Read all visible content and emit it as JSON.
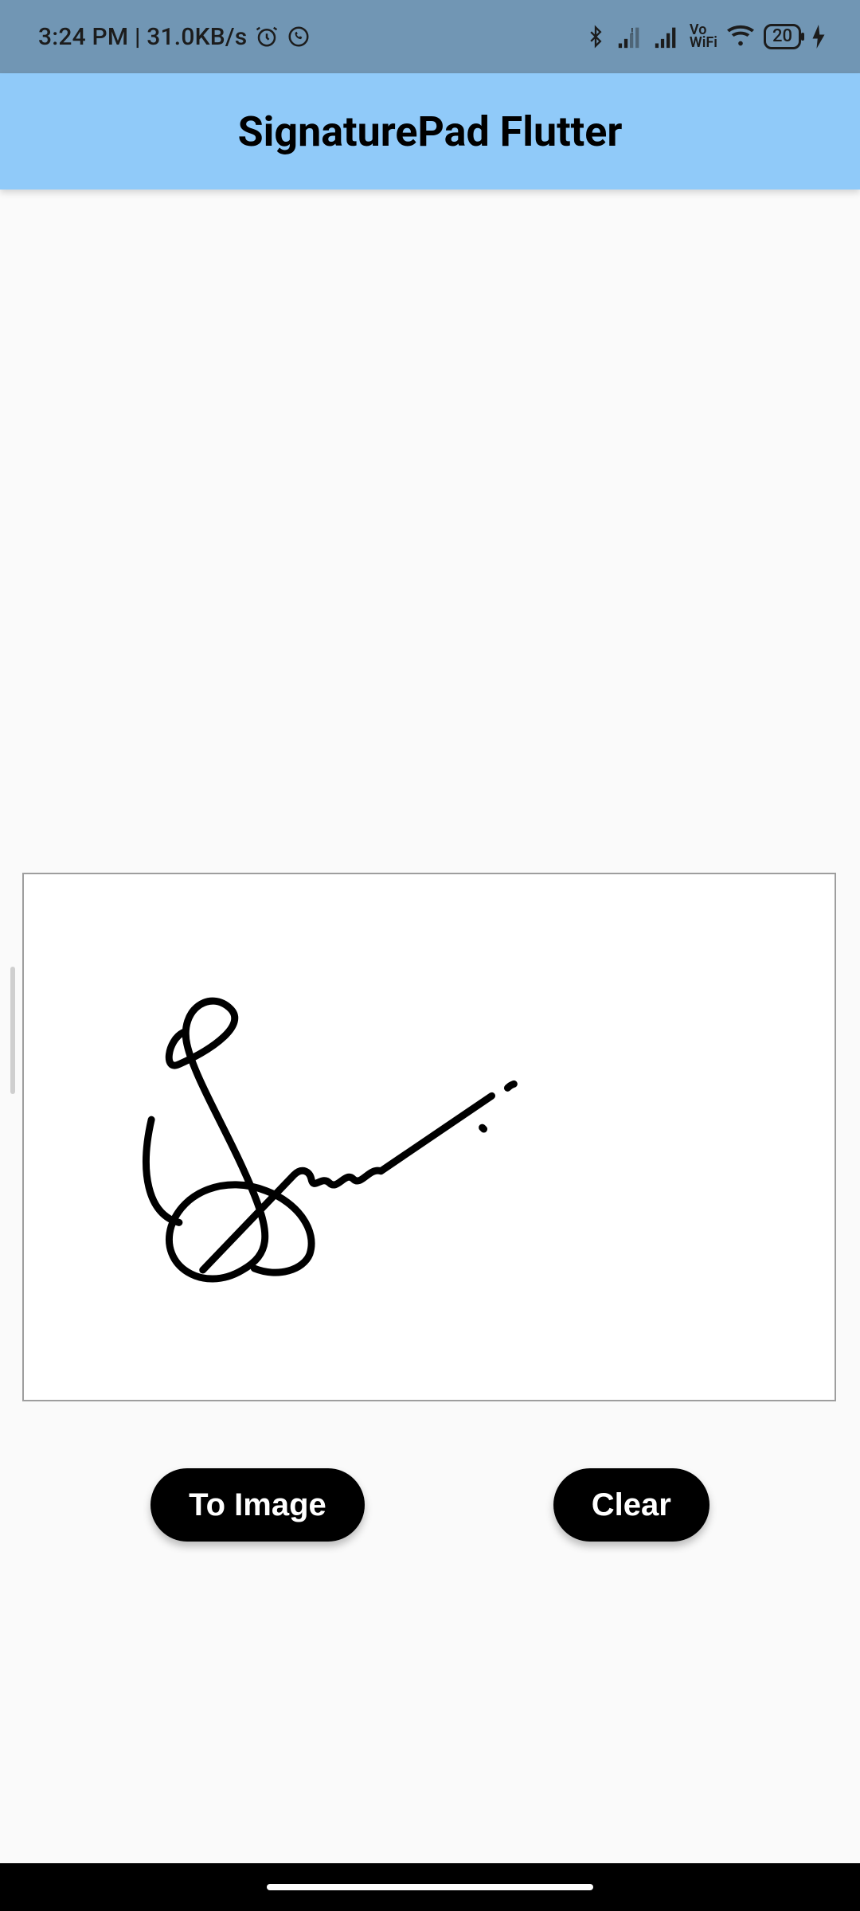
{
  "status_bar": {
    "time": "3:24 PM",
    "net_speed": "31.0KB/s",
    "battery_percent": "20",
    "wifi_label": "WiFi",
    "vo_label": "Vo"
  },
  "app_bar": {
    "title": "SignaturePad Flutter"
  },
  "buttons": {
    "to_image_label": "To Image",
    "clear_label": "Clear"
  },
  "colors": {
    "status_bar_bg": "#7196b4",
    "app_bar_bg": "#90caf9",
    "body_bg": "#fafafa",
    "button_bg": "#000000",
    "button_fg": "#ffffff",
    "signature_border": "#9e9e9e",
    "signature_bg": "#ffffff"
  }
}
